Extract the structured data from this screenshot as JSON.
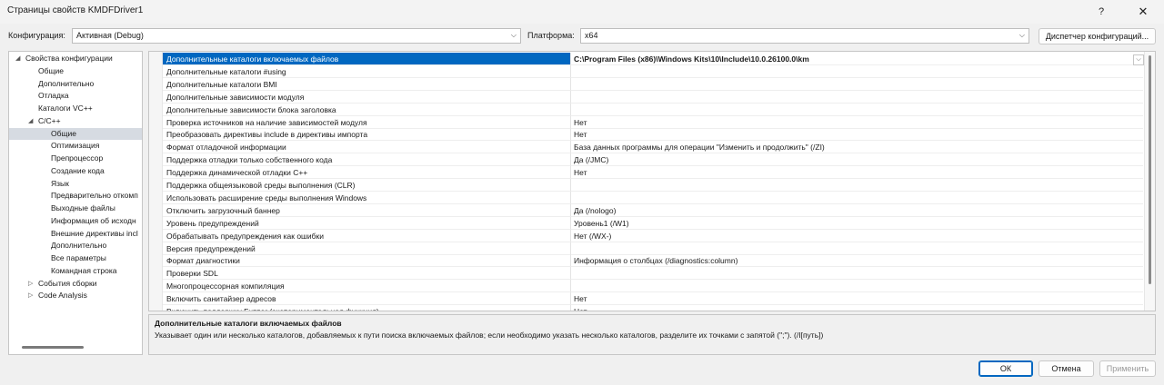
{
  "window": {
    "title": "Страницы свойств KMDFDriver1",
    "help": "?",
    "close": "✕"
  },
  "config_bar": {
    "config_label": "Конфигурация:",
    "config_value": "Активная (Debug)",
    "platform_label": "Платформа:",
    "platform_value": "x64",
    "manager_button": "Диспетчер конфигураций..."
  },
  "tree": [
    {
      "label": "Свойства конфигурации",
      "expander": "◢"
    },
    {
      "label": "Общие"
    },
    {
      "label": "Дополнительно"
    },
    {
      "label": "Отладка"
    },
    {
      "label": "Каталоги VC++"
    },
    {
      "label": "C/C++",
      "expander": "◢"
    },
    {
      "label": "Общие",
      "selected": true
    },
    {
      "label": "Оптимизация"
    },
    {
      "label": "Препроцессор"
    },
    {
      "label": "Создание кода"
    },
    {
      "label": "Язык"
    },
    {
      "label": "Предварительно откомп"
    },
    {
      "label": "Выходные файлы"
    },
    {
      "label": "Информация об исходн"
    },
    {
      "label": "Внешние директивы incl"
    },
    {
      "label": "Дополнительно"
    },
    {
      "label": "Все параметры"
    },
    {
      "label": "Командная строка"
    },
    {
      "label": "События сборки",
      "expander": "▷"
    },
    {
      "label": "Code Analysis",
      "expander": "▷"
    }
  ],
  "properties": [
    {
      "name": "Дополнительные каталоги включаемых файлов",
      "value": "C:\\Program Files (x86)\\Windows Kits\\10\\Include\\10.0.26100.0\\km",
      "selected": true
    },
    {
      "name": "Дополнительные каталоги #using",
      "value": ""
    },
    {
      "name": "Дополнительные каталоги BMI",
      "value": ""
    },
    {
      "name": "Дополнительные зависимости модуля",
      "value": ""
    },
    {
      "name": "Дополнительные зависимости блока заголовка",
      "value": ""
    },
    {
      "name": "Проверка источников на наличие зависимостей модуля",
      "value": "Нет"
    },
    {
      "name": "Преобразовать директивы include в директивы импорта",
      "value": "Нет"
    },
    {
      "name": "Формат отладочной информации",
      "value": "База данных программы для операции \"Изменить и продолжить\" (/ZI)"
    },
    {
      "name": "Поддержка отладки только собственного кода",
      "value": "Да (/JMC)"
    },
    {
      "name": "Поддержка динамической отладки C++",
      "value": "Нет"
    },
    {
      "name": "Поддержка общеязыковой среды выполнения (CLR)",
      "value": ""
    },
    {
      "name": "Использовать расширение среды выполнения Windows",
      "value": ""
    },
    {
      "name": "Отключить загрузочный баннер",
      "value": "Да (/nologo)"
    },
    {
      "name": "Уровень предупреждений",
      "value": "Уровень1 (/W1)"
    },
    {
      "name": "Обрабатывать предупреждения как ошибки",
      "value": "Нет (/WX-)"
    },
    {
      "name": "Версия предупреждений",
      "value": ""
    },
    {
      "name": "Формат диагностики",
      "value": "Информация о столбцах (/diagnostics:column)"
    },
    {
      "name": "Проверки SDL",
      "value": ""
    },
    {
      "name": "Многопроцессорная компиляция",
      "value": ""
    },
    {
      "name": "Включить санитайзер адресов",
      "value": "Нет"
    },
    {
      "name": "Включить поддержку Fuzzer (экспериментальная функция)",
      "value": "Нет"
    }
  ],
  "description": {
    "title": "Дополнительные каталоги включаемых файлов",
    "text": "Указывает один или несколько каталогов, добавляемых к пути поиска включаемых файлов; если необходимо указать несколько каталогов, разделите их точками с запятой (\";\").     (/I[путь])"
  },
  "buttons": {
    "ok": "ОК",
    "cancel": "Отмена",
    "apply": "Применить"
  },
  "icons": {
    "combo_arrow": "chevron-down-icon",
    "value_dropdown": "chevron-down-icon"
  }
}
